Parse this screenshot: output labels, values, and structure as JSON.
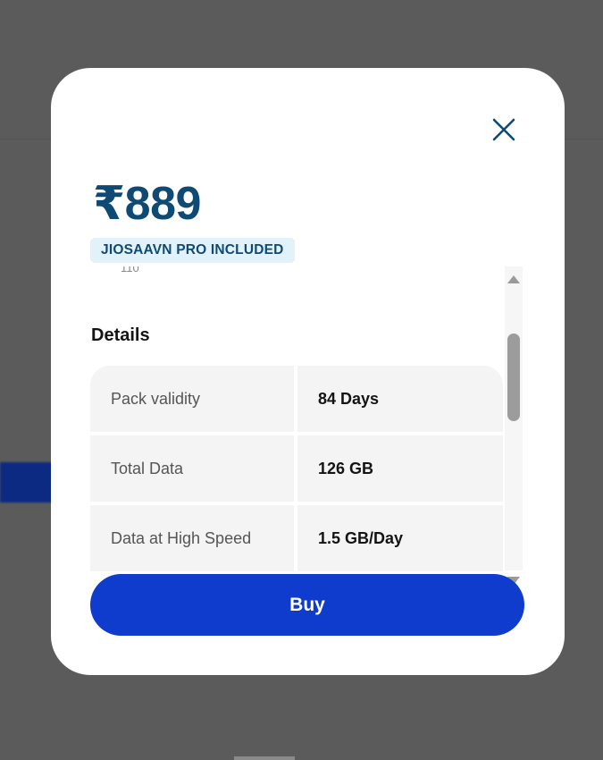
{
  "modal": {
    "price": "₹889",
    "badge": "JIOSAAVN PRO INCLUDED",
    "cut_text": "110",
    "details_title": "Details",
    "details": [
      {
        "label": "Pack validity",
        "value": "84 Days"
      },
      {
        "label": "Total Data",
        "value": "126 GB"
      },
      {
        "label": "Data at High Speed",
        "value": "1.5 GB/Day"
      }
    ],
    "buy_label": "Buy"
  },
  "colors": {
    "price": "#0f4a74",
    "badge_bg": "#e1f2fb",
    "buy_button": "#0f3ccc",
    "overlay": "#5b5b5b"
  },
  "icons": {
    "close": "close-icon",
    "scroll_up": "arrow-up-icon",
    "scroll_down": "arrow-down-icon"
  }
}
